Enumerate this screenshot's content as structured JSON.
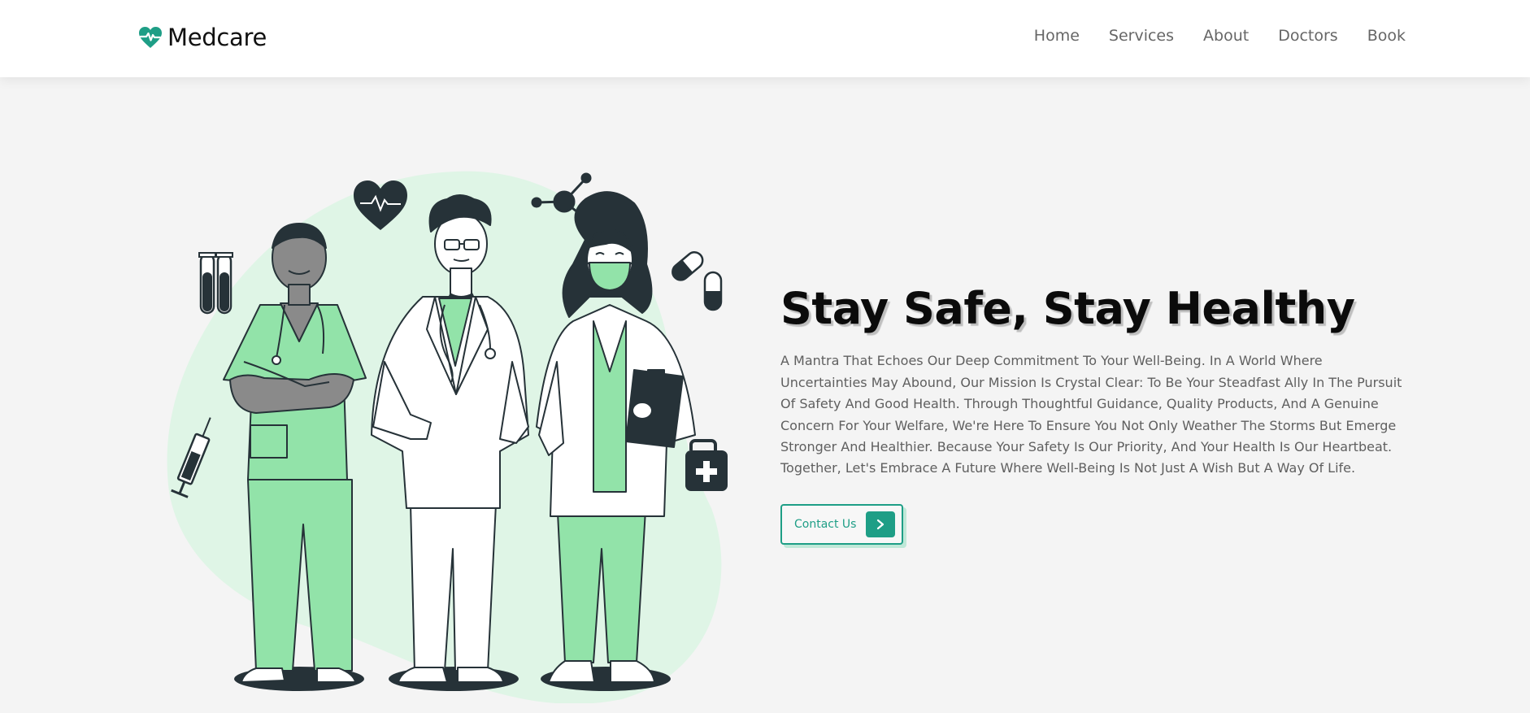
{
  "brand": {
    "name": "Medcare",
    "icon": "heart-pulse-icon",
    "accent_color": "#1e9e86"
  },
  "nav": {
    "items": [
      {
        "label": "Home"
      },
      {
        "label": "Services"
      },
      {
        "label": "About"
      },
      {
        "label": "Doctors"
      },
      {
        "label": "Book"
      }
    ]
  },
  "hero": {
    "title": "Stay Safe, Stay Healthy",
    "description": "A Mantra That Echoes Our Deep Commitment To Your Well-Being. In A World Where Uncertainties May Abound, Our Mission Is Crystal Clear: To Be Your Steadfast Ally In The Pursuit Of Safety And Good Health. Through Thoughtful Guidance, Quality Products, And A Genuine Concern For Your Welfare, We're Here To Ensure You Not Only Weather The Storms But Emerge Stronger And Healthier. Because Your Safety Is Our Priority, And Your Health Is Our Heartbeat. Together, Let's Embrace A Future Where Well-Being Is Not Just A Wish But A Way Of Life.",
    "cta_label": "Contact Us",
    "cta_icon": "chevron-right-icon",
    "illustration": "medical-staff-illustration"
  },
  "colors": {
    "page_background": "#f4f4f4",
    "illustration_blob": "#dff5e6",
    "scrubs_green": "#92e3a9",
    "dark_ink": "#263238"
  }
}
